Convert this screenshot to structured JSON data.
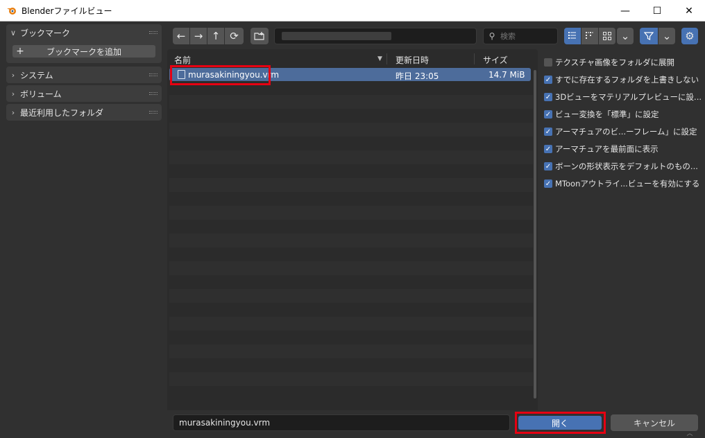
{
  "window": {
    "title": "Blenderファイルビュー",
    "minimize_icon": "minimize-icon",
    "maximize_icon": "maximize-icon",
    "close_icon": "close-icon",
    "glyphs": {
      "minimize": "—",
      "maximize": "☐",
      "close": "✕"
    }
  },
  "sidebar": {
    "bookmarks": {
      "label": "ブックマーク",
      "add_label": "ブックマークを追加",
      "add_glyph": "+"
    },
    "system": {
      "label": "システム"
    },
    "volumes": {
      "label": "ボリューム"
    },
    "recent": {
      "label": "最近利用したフォルダ"
    },
    "chevron_open": "∨",
    "chevron_closed": "›"
  },
  "toolbar": {
    "back_glyph": "←",
    "forward_glyph": "→",
    "parent_glyph": "↑",
    "refresh_glyph": "⟳",
    "new_folder_glyph": "▣",
    "search_placeholder": "検索",
    "search_glyph": "⚲",
    "display_modes": [
      "vertical-list",
      "horizontal-list",
      "thumbnails"
    ],
    "dropdown_glyph": "⌄",
    "filter_glyph": "⧩",
    "settings_glyph": "⚙",
    "accent": "#4772b3"
  },
  "filelist": {
    "columns": {
      "name": "名前",
      "date": "更新日時",
      "size": "サイズ",
      "sort_glyph": "▼"
    },
    "files": [
      {
        "name": "murasakiningyou.vrm",
        "date": "昨日 23:05",
        "size": "14.7 MiB",
        "selected": true
      }
    ]
  },
  "options": [
    {
      "label": "テクスチャ画像をフォルダに展開",
      "checked": false
    },
    {
      "label": "すでに存在するフォルダを上書きしない",
      "checked": true
    },
    {
      "label": "3Dビューをマテリアルプレビューに設...",
      "checked": true
    },
    {
      "label": "ビュー変換を「標準」に設定",
      "checked": true
    },
    {
      "label": "アーマチュアのビ...ーフレーム」に設定",
      "checked": true
    },
    {
      "label": "アーマチュアを最前面に表示",
      "checked": true
    },
    {
      "label": "ボーンの形状表示をデフォルトのもの...",
      "checked": true
    },
    {
      "label": "MToonアウトライ...ビューを有効にする",
      "checked": true
    }
  ],
  "bottom": {
    "filename": "murasakiningyou.vrm",
    "open_label": "開く",
    "cancel_label": "キャンセル"
  },
  "colors": {
    "highlight": "#e60012",
    "selection": "#4d6c9b"
  }
}
